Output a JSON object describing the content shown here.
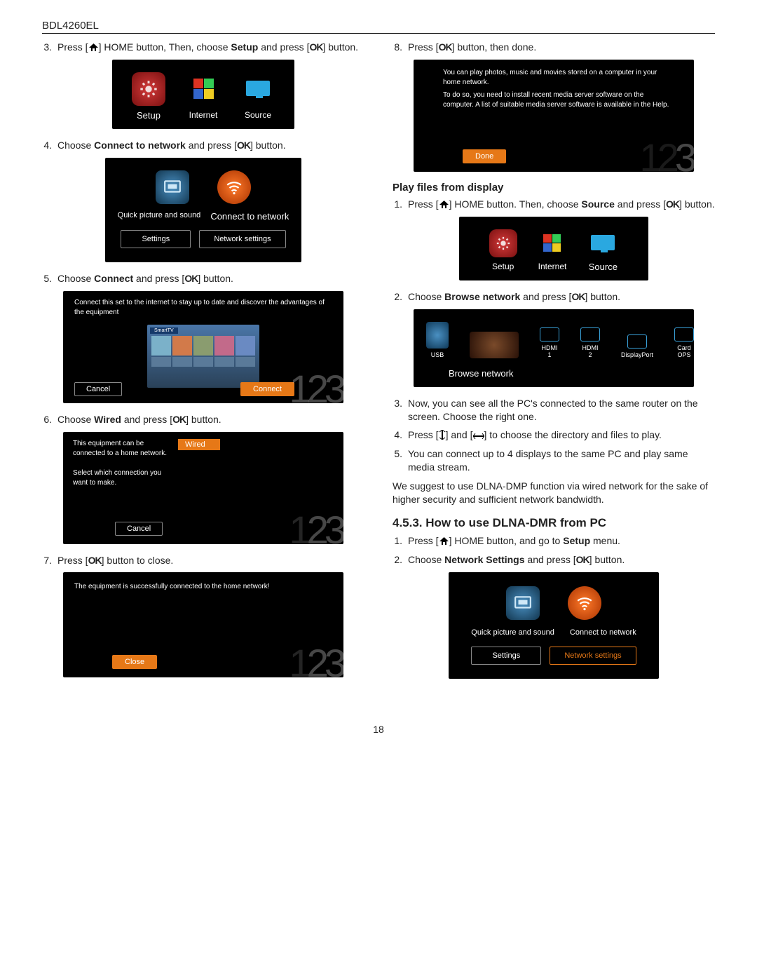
{
  "header": {
    "model": "BDL4260EL"
  },
  "left": {
    "step3": {
      "n": "3.",
      "pre": "Press [",
      "mid": "] HOME button, Then, choose ",
      "bold": "Setup",
      "post": " and press [",
      "end": "] button."
    },
    "shot3": {
      "setup": "Setup",
      "internet": "Internet",
      "source": "Source"
    },
    "step4": {
      "n": "4.",
      "pre": "Choose ",
      "bold": "Connect to network",
      "post": " and press [",
      "end": "] button."
    },
    "shot4": {
      "qps": "Quick picture and sound",
      "ctn": "Connect to network",
      "settings": "Settings",
      "ns": "Network settings"
    },
    "step5": {
      "n": "5.",
      "pre": "Choose ",
      "bold": "Connect",
      "post": " and press [",
      "end": "] button."
    },
    "shot5": {
      "banner": "Connect this set to the internet to stay up to date and discover the advantages of the equipment",
      "cancel": "Cancel",
      "connect": "Connect"
    },
    "step6": {
      "n": "6.",
      "pre": "Choose ",
      "bold": "Wired",
      "post": " and press [",
      "end": "] button."
    },
    "shot6": {
      "line1": "This equipment can be connected to a home network.",
      "line2": "Select which connection you want to make.",
      "wired": "Wired",
      "cancel": "Cancel"
    },
    "step7": {
      "n": "7.",
      "pre": "Press [",
      "post": "] button to close."
    },
    "shot7": {
      "msg": "The equipment is successfully connected to the home network!",
      "close": "Close"
    }
  },
  "right": {
    "step8": {
      "n": "8.",
      "pre": "Press [",
      "post": "] button, then done."
    },
    "shot8": {
      "l1": "You can play photos, music and movies stored on a computer in your home network.",
      "l2": "To do so, you need to install recent media server software on the computer. A list of suitable media server software is available in the Help.",
      "done": "Done"
    },
    "sub1": "Play files from display",
    "r1": {
      "n": "1.",
      "pre": "Press [",
      "mid": "] HOME button. Then, choose ",
      "bold": "Source",
      "post": " and press [",
      "end": "] button."
    },
    "shotR1": {
      "setup": "Setup",
      "internet": "Internet",
      "source": "Source"
    },
    "r2": {
      "n": "2.",
      "pre": "Choose ",
      "bold": "Browse network",
      "post": " and press [",
      "end": "] button."
    },
    "shotR2": {
      "usb": "USB",
      "h1": "HDMI 1",
      "h2": "HDMI 2",
      "dp": "DisplayPort",
      "co": "Card OPS",
      "bn": "Browse network"
    },
    "r3": {
      "n": "3.",
      "txt": "Now, you can see all the PC's connected to the same router on the screen. Choose the right one."
    },
    "r4": {
      "n": "4.",
      "pre": "Press [",
      "mid": "] and [",
      "post": "] to choose the directory and files to play."
    },
    "r5": {
      "n": "5.",
      "txt": "You can connect up to 4 displays to the same PC and play same media stream."
    },
    "para": "We suggest to use DLNA-DMP function via wired network for the sake of higher security and sufficient network bandwidth.",
    "sect": "4.5.3.  How to use DLNA-DMR from PC",
    "d1": {
      "n": "1.",
      "pre": "Press [",
      "mid": "] HOME button, and go to ",
      "bold": "Setup",
      "post": " menu."
    },
    "d2": {
      "n": "2.",
      "pre": "Choose ",
      "bold": "Network Settings",
      "post": " and press [",
      "end": "] button."
    },
    "shotD": {
      "qps": "Quick picture and sound",
      "ctn": "Connect to network",
      "settings": "Settings",
      "ns": "Network settings"
    }
  },
  "footer": {
    "page": "18"
  }
}
